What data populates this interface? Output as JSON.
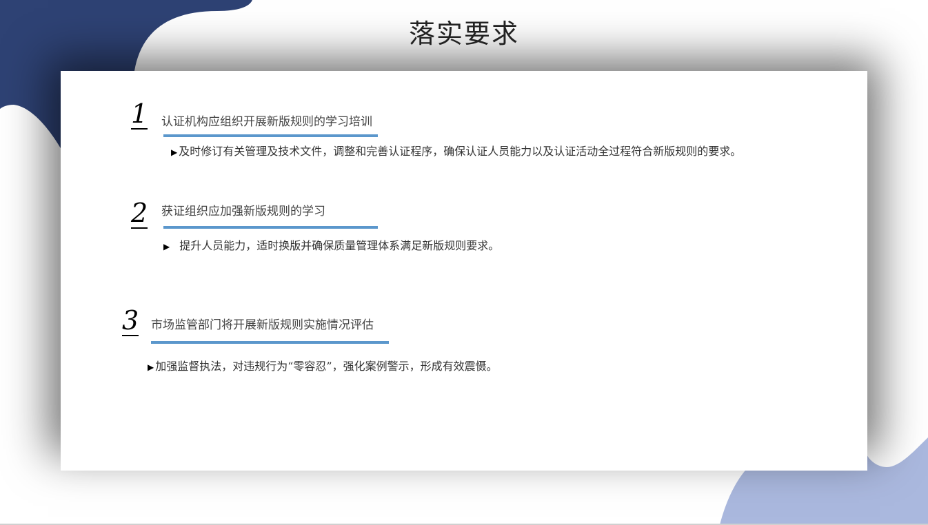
{
  "slide": {
    "title": "落实要求",
    "colors": {
      "dark_blob": "#2e4274",
      "light_blob": "#aab8de",
      "accent_rule": "#5b97cc"
    },
    "sections": [
      {
        "number": "1",
        "heading": "认证机构应组织开展新版规则的学习培训",
        "bullet_icon": "triangle-right-icon",
        "bullet": "及时修订有关管理及技术文件，调整和完善认证程序，确保认证人员能力以及认证活动全过程符合新版规则的要求。"
      },
      {
        "number": "2",
        "heading": "获证组织应加强新版规则的学习",
        "bullet_icon": "triangle-right-icon",
        "bullet": "提升人员能力，适时换版并确保质量管理体系满足新版规则要求。"
      },
      {
        "number": "3",
        "heading": "市场监管部门将开展新版规则实施情况评估",
        "bullet_icon": "triangle-right-icon",
        "bullet": "加强监督执法，对违规行为“零容忍”，强化案例警示，形成有效震慑。"
      }
    ]
  }
}
